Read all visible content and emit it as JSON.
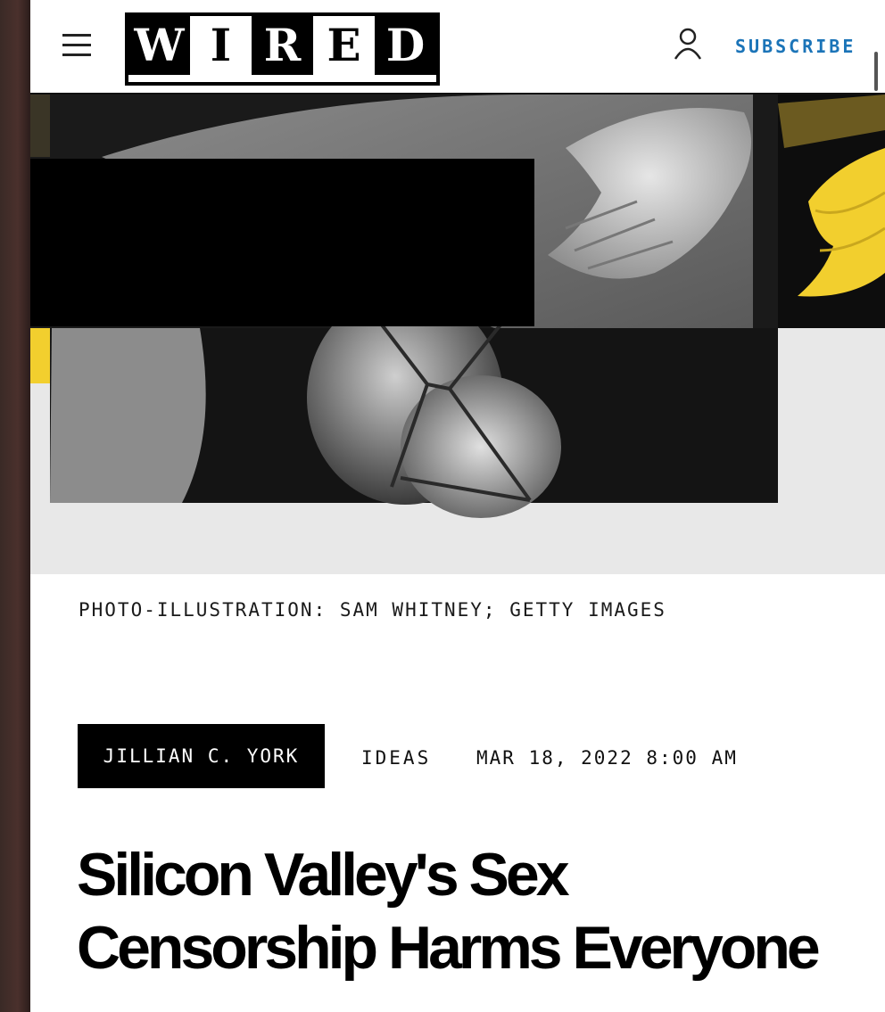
{
  "header": {
    "menu_icon": "hamburger-menu-icon",
    "logo_letters": [
      "W",
      "I",
      "R",
      "E",
      "D"
    ],
    "account_icon": "user-icon",
    "subscribe_label": "SUBSCRIBE"
  },
  "hero": {
    "photo_credit": "PHOTO-ILLUSTRATION: SAM WHITNEY; GETTY IMAGES"
  },
  "article": {
    "author": "JILLIAN C. YORK",
    "section": "IDEAS",
    "date": "MAR 18, 2022 8:00 AM",
    "headline": "Silicon Valley's Sex Censorship Harms Everyone"
  },
  "colors": {
    "subscribe_link": "#1b74b8",
    "accent_yellow": "#f2cf2e",
    "badge_background": "#000000"
  }
}
